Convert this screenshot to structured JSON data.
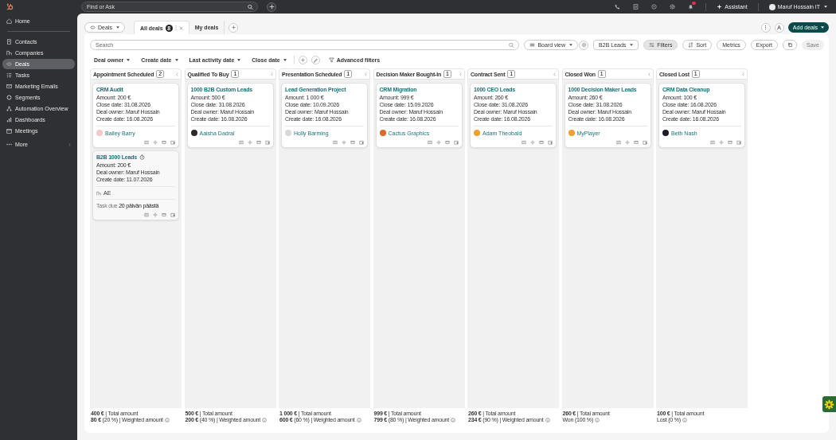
{
  "top_bar": {
    "search_placeholder": "Find or Ask",
    "assistant": "Assistant",
    "user": "Maruf Hossain IT",
    "notifications": true
  },
  "sidebar": {
    "items": [
      {
        "label": "Home",
        "selected": false
      },
      {
        "label": "Contacts",
        "selected": false
      },
      {
        "label": "Companies",
        "selected": false
      },
      {
        "label": "Deals",
        "selected": true
      },
      {
        "label": "Tasks",
        "selected": false
      },
      {
        "label": "Marketing Emails",
        "selected": false
      },
      {
        "label": "Segments",
        "selected": false
      },
      {
        "label": "Automation Overview",
        "selected": false
      },
      {
        "label": "Dashboards",
        "selected": false
      },
      {
        "label": "Meetings",
        "selected": false
      }
    ],
    "more": "More"
  },
  "object_switcher": "Deals",
  "tabs": [
    {
      "label": "All deals",
      "count": "8",
      "selected": true
    },
    {
      "label": "My deals",
      "selected": false
    }
  ],
  "add_button": "Add deals",
  "toolbar": {
    "search_placeholder": "Search",
    "view": "Board view",
    "pipeline": "B2B Leads",
    "buttons": [
      {
        "label": "Filters",
        "selected": true
      },
      {
        "label": "Sort",
        "selected": false
      },
      {
        "label": "Metrics",
        "selected": false
      },
      {
        "label": "Export",
        "selected": false
      }
    ],
    "save": "Save",
    "save_disabled": true
  },
  "filters": [
    "Deal owner",
    "Create date",
    "Last activity date",
    "Close date"
  ],
  "advanced_filters": "Advanced filters",
  "columns": [
    {
      "title": "Appointment Scheduled",
      "count": "2",
      "cards": [
        {
          "title": "CRM Audit",
          "overdue": false,
          "lines": [
            "Amount: 200 €",
            "Close date: 31.08.2026",
            "Deal owner: Maruf Hossain",
            "Create date: 16.08.2026"
          ],
          "contact": {
            "name": "Bailey Barry",
            "color": "#f3c9c9"
          }
        },
        {
          "title": "B2B 1000 Leads",
          "overdue": true,
          "lines": [
            "Amount: 200 €",
            "Deal owner: Maruf Hossain",
            "Create date: 11.07.2026"
          ],
          "company": "AE",
          "task": "Task due **20 päivän päästä**"
        }
      ],
      "total": "**400 €** | Total amount",
      "weighted": "**80 €** (20 %) | Weighted amount"
    },
    {
      "title": "Qualified To Buy",
      "count": "1",
      "cards": [
        {
          "title": "1000 B2B Custom Leads",
          "overdue": false,
          "lines": [
            "Amount: 500 €",
            "Close date: 31.08.2026",
            "Deal owner: Maruf Hossain",
            "Create date: 16.08.2026"
          ],
          "contact": {
            "name": "Aaisha Dadral",
            "color": "#2b2b2b"
          }
        }
      ],
      "total": "**500 €** | Total amount",
      "weighted": "**200 €** (40 %) | Weighted amount"
    },
    {
      "title": "Presentation Scheduled",
      "count": "1",
      "cards": [
        {
          "title": "Lead Generation Project",
          "overdue": false,
          "lines": [
            "Amount: 1 000 €",
            "Close date: 10.09.2026",
            "Deal owner: Maruf Hossain",
            "Create date: 16.08.2026"
          ],
          "contact": {
            "name": "Holly Barming",
            "color": "#d9d9d9"
          }
        }
      ],
      "total": "**1 000 €** | Total amount",
      "weighted": "**600 €** (60 %) | Weighted amount"
    },
    {
      "title": "Decision Maker Bought-In",
      "count": "1",
      "cards": [
        {
          "title": "CRM Migration",
          "overdue": false,
          "lines": [
            "Amount: 999 €",
            "Close date: 15.09.2026",
            "Deal owner: Maruf Hossain",
            "Create date: 16.08.2026"
          ],
          "contact": {
            "name": "Cactus Graphics",
            "color": "#e0672c"
          }
        }
      ],
      "total": "**999 €** | Total amount",
      "weighted": "**799 €** (80 %) | Weighted amount"
    },
    {
      "title": "Contract Sent",
      "count": "1",
      "cards": [
        {
          "title": "1000 CEO Leads",
          "overdue": false,
          "lines": [
            "Amount: 260 €",
            "Close date: 31.08.2026",
            "Deal owner: Maruf Hossain",
            "Create date: 16.08.2026"
          ],
          "contact": {
            "name": "Adam Theobald",
            "color": "#f0a030"
          }
        }
      ],
      "total": "**260 €** | Total amount",
      "weighted": "**234 €** (90 %) | Weighted amount"
    },
    {
      "title": "Closed Won",
      "count": "1",
      "cards": [
        {
          "title": "1000 Decision Maker Leads",
          "overdue": false,
          "lines": [
            "Amount: 260 €",
            "Close date: 31.08.2026",
            "Deal owner: Maruf Hossain",
            "Create date: 16.08.2026"
          ],
          "contact": {
            "name": "MyPlayer",
            "color": "#f0a030"
          }
        }
      ],
      "total": "**260 €** | Total amount",
      "weighted": "Won (100 %)"
    },
    {
      "title": "Closed Lost",
      "count": "1",
      "cards": [
        {
          "title": "CRM Data Cleanup",
          "overdue": false,
          "lines": [
            "Amount: 100 €",
            "Close date: 16.08.2026",
            "Deal owner: Maruf Hossain",
            "Create date: 16.08.2026"
          ],
          "contact": {
            "name": "Beth Nash",
            "color": "#1c1c2a"
          }
        }
      ],
      "total": "**100 €** | Total amount",
      "weighted": "Lost (0 %)"
    }
  ]
}
